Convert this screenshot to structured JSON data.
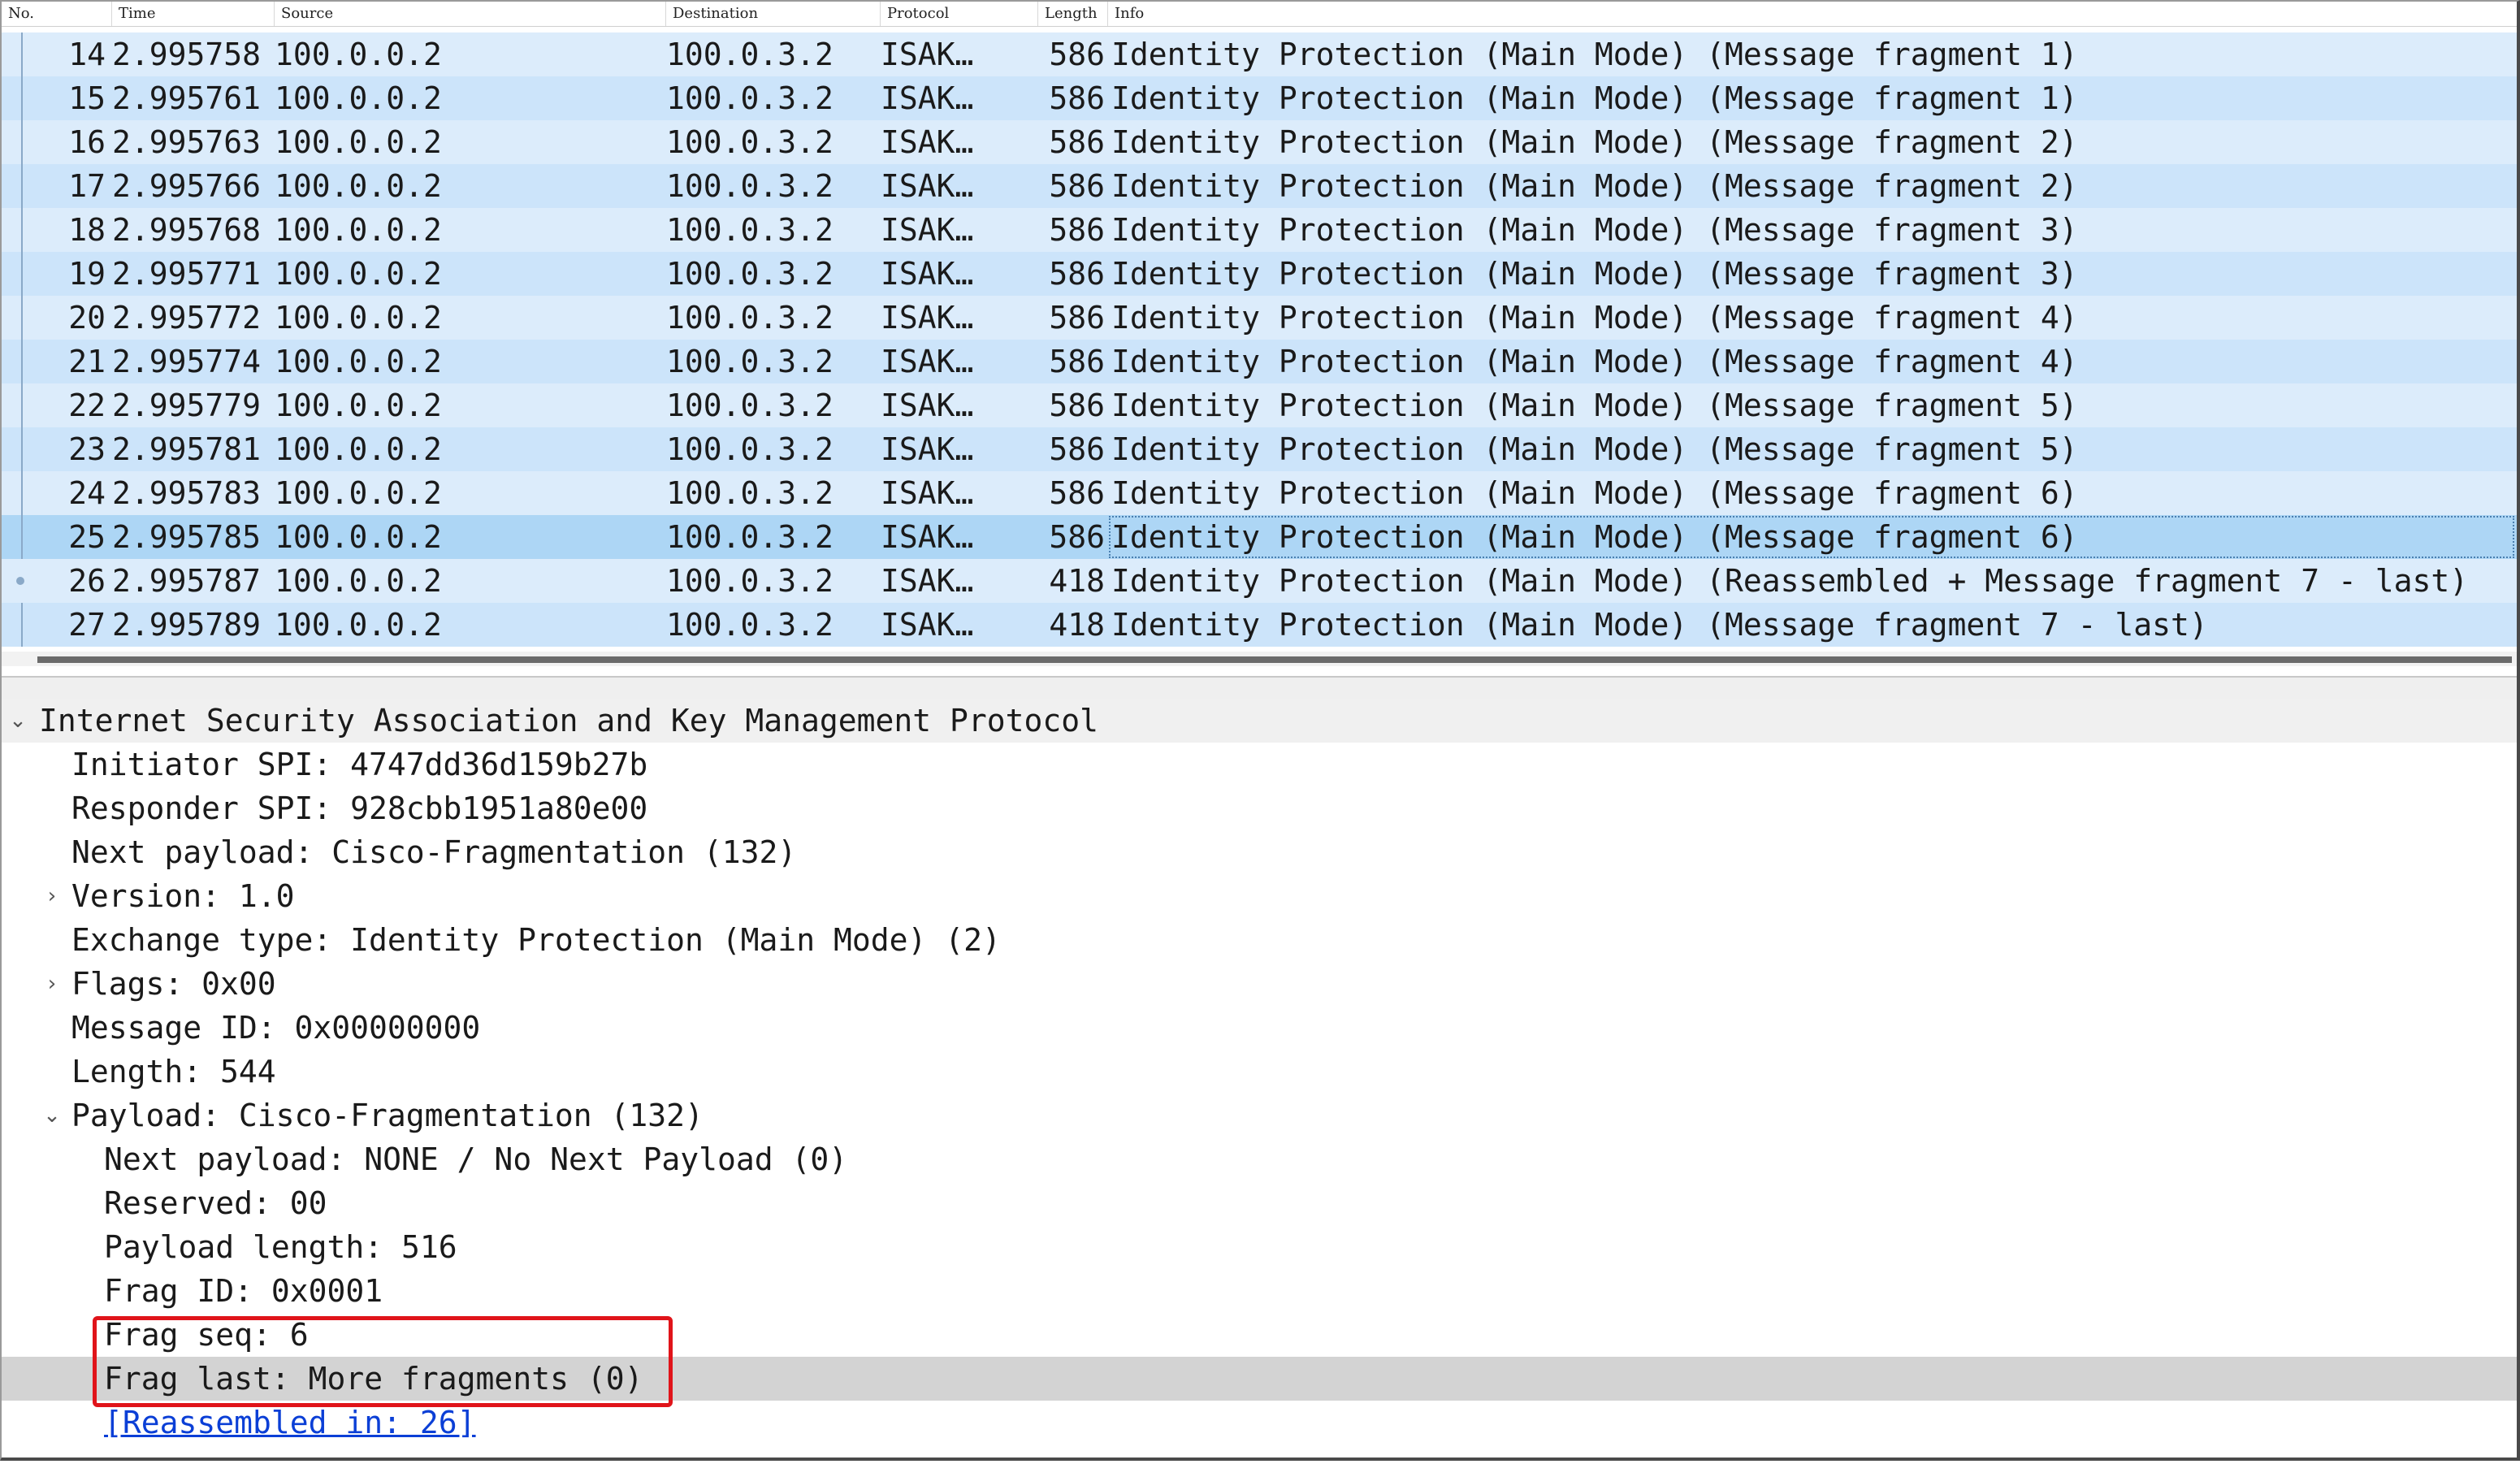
{
  "columns": {
    "no": "No.",
    "time": "Time",
    "source": "Source",
    "destination": "Destination",
    "protocol": "Protocol",
    "length": "Length",
    "info": "Info"
  },
  "packets": [
    {
      "no": "14",
      "time": "2.995758",
      "source": "100.0.0.2",
      "destination": "100.0.3.2",
      "protocol": "ISAK…",
      "length": "586",
      "info": "Identity Protection (Main Mode) (Message fragment 1)"
    },
    {
      "no": "15",
      "time": "2.995761",
      "source": "100.0.0.2",
      "destination": "100.0.3.2",
      "protocol": "ISAK…",
      "length": "586",
      "info": "Identity Protection (Main Mode) (Message fragment 1)"
    },
    {
      "no": "16",
      "time": "2.995763",
      "source": "100.0.0.2",
      "destination": "100.0.3.2",
      "protocol": "ISAK…",
      "length": "586",
      "info": "Identity Protection (Main Mode) (Message fragment 2)"
    },
    {
      "no": "17",
      "time": "2.995766",
      "source": "100.0.0.2",
      "destination": "100.0.3.2",
      "protocol": "ISAK…",
      "length": "586",
      "info": "Identity Protection (Main Mode) (Message fragment 2)"
    },
    {
      "no": "18",
      "time": "2.995768",
      "source": "100.0.0.2",
      "destination": "100.0.3.2",
      "protocol": "ISAK…",
      "length": "586",
      "info": "Identity Protection (Main Mode) (Message fragment 3)"
    },
    {
      "no": "19",
      "time": "2.995771",
      "source": "100.0.0.2",
      "destination": "100.0.3.2",
      "protocol": "ISAK…",
      "length": "586",
      "info": "Identity Protection (Main Mode) (Message fragment 3)"
    },
    {
      "no": "20",
      "time": "2.995772",
      "source": "100.0.0.2",
      "destination": "100.0.3.2",
      "protocol": "ISAK…",
      "length": "586",
      "info": "Identity Protection (Main Mode) (Message fragment 4)"
    },
    {
      "no": "21",
      "time": "2.995774",
      "source": "100.0.0.2",
      "destination": "100.0.3.2",
      "protocol": "ISAK…",
      "length": "586",
      "info": "Identity Protection (Main Mode) (Message fragment 4)"
    },
    {
      "no": "22",
      "time": "2.995779",
      "source": "100.0.0.2",
      "destination": "100.0.3.2",
      "protocol": "ISAK…",
      "length": "586",
      "info": "Identity Protection (Main Mode) (Message fragment 5)"
    },
    {
      "no": "23",
      "time": "2.995781",
      "source": "100.0.0.2",
      "destination": "100.0.3.2",
      "protocol": "ISAK…",
      "length": "586",
      "info": "Identity Protection (Main Mode) (Message fragment 5)"
    },
    {
      "no": "24",
      "time": "2.995783",
      "source": "100.0.0.2",
      "destination": "100.0.3.2",
      "protocol": "ISAK…",
      "length": "586",
      "info": "Identity Protection (Main Mode) (Message fragment 6)"
    },
    {
      "no": "25",
      "time": "2.995785",
      "source": "100.0.0.2",
      "destination": "100.0.3.2",
      "protocol": "ISAK…",
      "length": "586",
      "info": "Identity Protection (Main Mode) (Message fragment 6)"
    },
    {
      "no": "26",
      "time": "2.995787",
      "source": "100.0.0.2",
      "destination": "100.0.3.2",
      "protocol": "ISAK…",
      "length": "418",
      "info": "Identity Protection (Main Mode) (Reassembled + Message fragment 7 - last)"
    },
    {
      "no": "27",
      "time": "2.995789",
      "source": "100.0.0.2",
      "destination": "100.0.3.2",
      "protocol": "ISAK…",
      "length": "418",
      "info": "Identity Protection (Main Mode) (Message fragment 7 - last)"
    }
  ],
  "selected_packet": "25",
  "details": {
    "root": "Internet Security Association and Key Management Protocol",
    "initiator_spi": "Initiator SPI: 4747dd36d159b27b",
    "responder_spi": "Responder SPI: 928cbb1951a80e00",
    "next_payload": "Next payload: Cisco-Fragmentation (132)",
    "version": "Version: 1.0",
    "exchange_type": "Exchange type: Identity Protection (Main Mode) (2)",
    "flags": "Flags: 0x00",
    "message_id": "Message ID: 0x00000000",
    "length": "Length: 544",
    "payload": "Payload: Cisco-Fragmentation (132)",
    "payload_next": "Next payload: NONE / No Next Payload  (0)",
    "reserved": "Reserved: 00",
    "payload_length": "Payload length: 516",
    "frag_id": "Frag ID: 0x0001",
    "frag_seq": "Frag seq: 6",
    "frag_last": "Frag last: More fragments (0)",
    "reassembled_in": "[Reassembled in: 26]"
  },
  "colors": {
    "row_bg": "#dcecfb",
    "row_selected": "#add6f5",
    "highlight_box": "#e0141a",
    "link": "#0b3fd6"
  },
  "icons": {
    "expanded": "chevron-down-icon",
    "collapsed": "chevron-right-icon"
  }
}
